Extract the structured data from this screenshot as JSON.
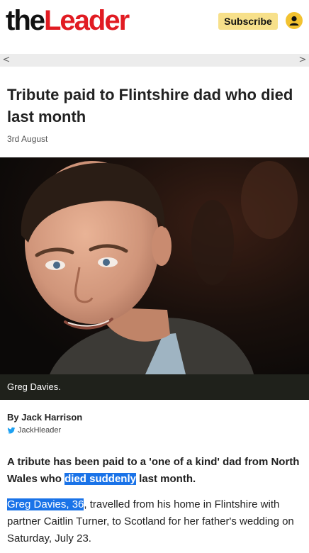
{
  "header": {
    "logo_the": "the",
    "logo_leader": "Leader",
    "subscribe_label": "Subscribe",
    "account_icon": "user-icon"
  },
  "nav": {
    "left_arrow": "<",
    "right_arrow": ">"
  },
  "article": {
    "headline": "Tribute paid to Flintshire dad who died last month",
    "date": "3rd August",
    "caption": "Greg Davies.",
    "byline": "By Jack Harrison",
    "twitter_handle": "JackHleader",
    "lede_before": "A tribute has been paid to a 'one of a kind' dad from North Wales who ",
    "lede_highlight": "died suddenly",
    "lede_after": " last month.",
    "body_highlight": "Greg Davies, 36",
    "body_after": ", travelled from his home in Flintshire with partner Caitlin Turner, to Scotland for her father's wedding on Saturday, July 23."
  },
  "colors": {
    "brand_red": "#e11b22",
    "subscribe_bg": "#f7e08a",
    "highlight_blue": "#1a73e8",
    "caption_bg": "#1f211b"
  }
}
